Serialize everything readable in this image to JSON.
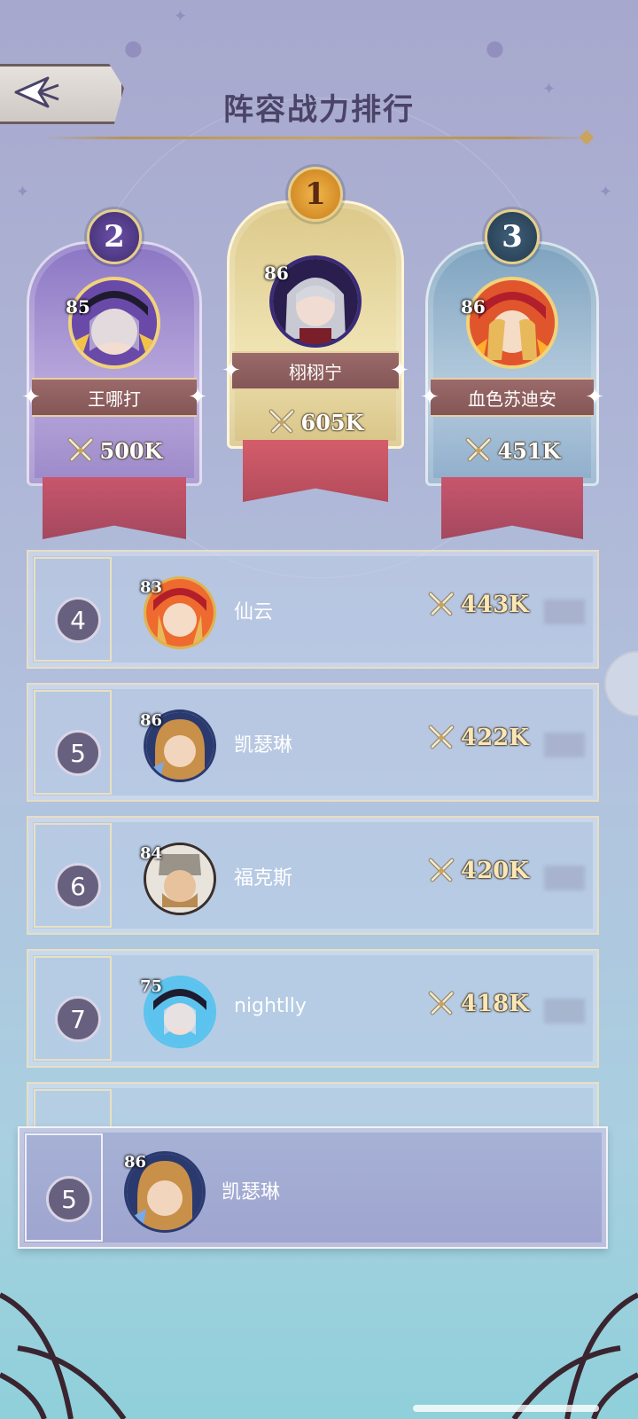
{
  "header": {
    "title": "阵容战力排行"
  },
  "podium": [
    {
      "rank": "2",
      "level": "85",
      "name": "王哪打",
      "power": "500K"
    },
    {
      "rank": "1",
      "level": "86",
      "name": "栩栩宁",
      "power": "605K"
    },
    {
      "rank": "3",
      "level": "86",
      "name": "血色苏迪安",
      "power": "451K"
    }
  ],
  "rows": [
    {
      "rank": "4",
      "level": "83",
      "name": "仙云",
      "power": "443K"
    },
    {
      "rank": "5",
      "level": "86",
      "name": "凯瑟琳",
      "power": "422K"
    },
    {
      "rank": "6",
      "level": "84",
      "name": "福克斯",
      "power": "420K"
    },
    {
      "rank": "7",
      "level": "75",
      "name": "nightlly",
      "power": "418K"
    }
  ],
  "my_rank": {
    "rank": "5",
    "level": "86",
    "name": "凯瑟琳"
  },
  "icons": {
    "back": "back-arrow-icon",
    "power": "crossed-swords-icon"
  },
  "colors": {
    "gold": "#c9a45f",
    "title": "#4b4368",
    "rank_circle": "#67607e"
  }
}
